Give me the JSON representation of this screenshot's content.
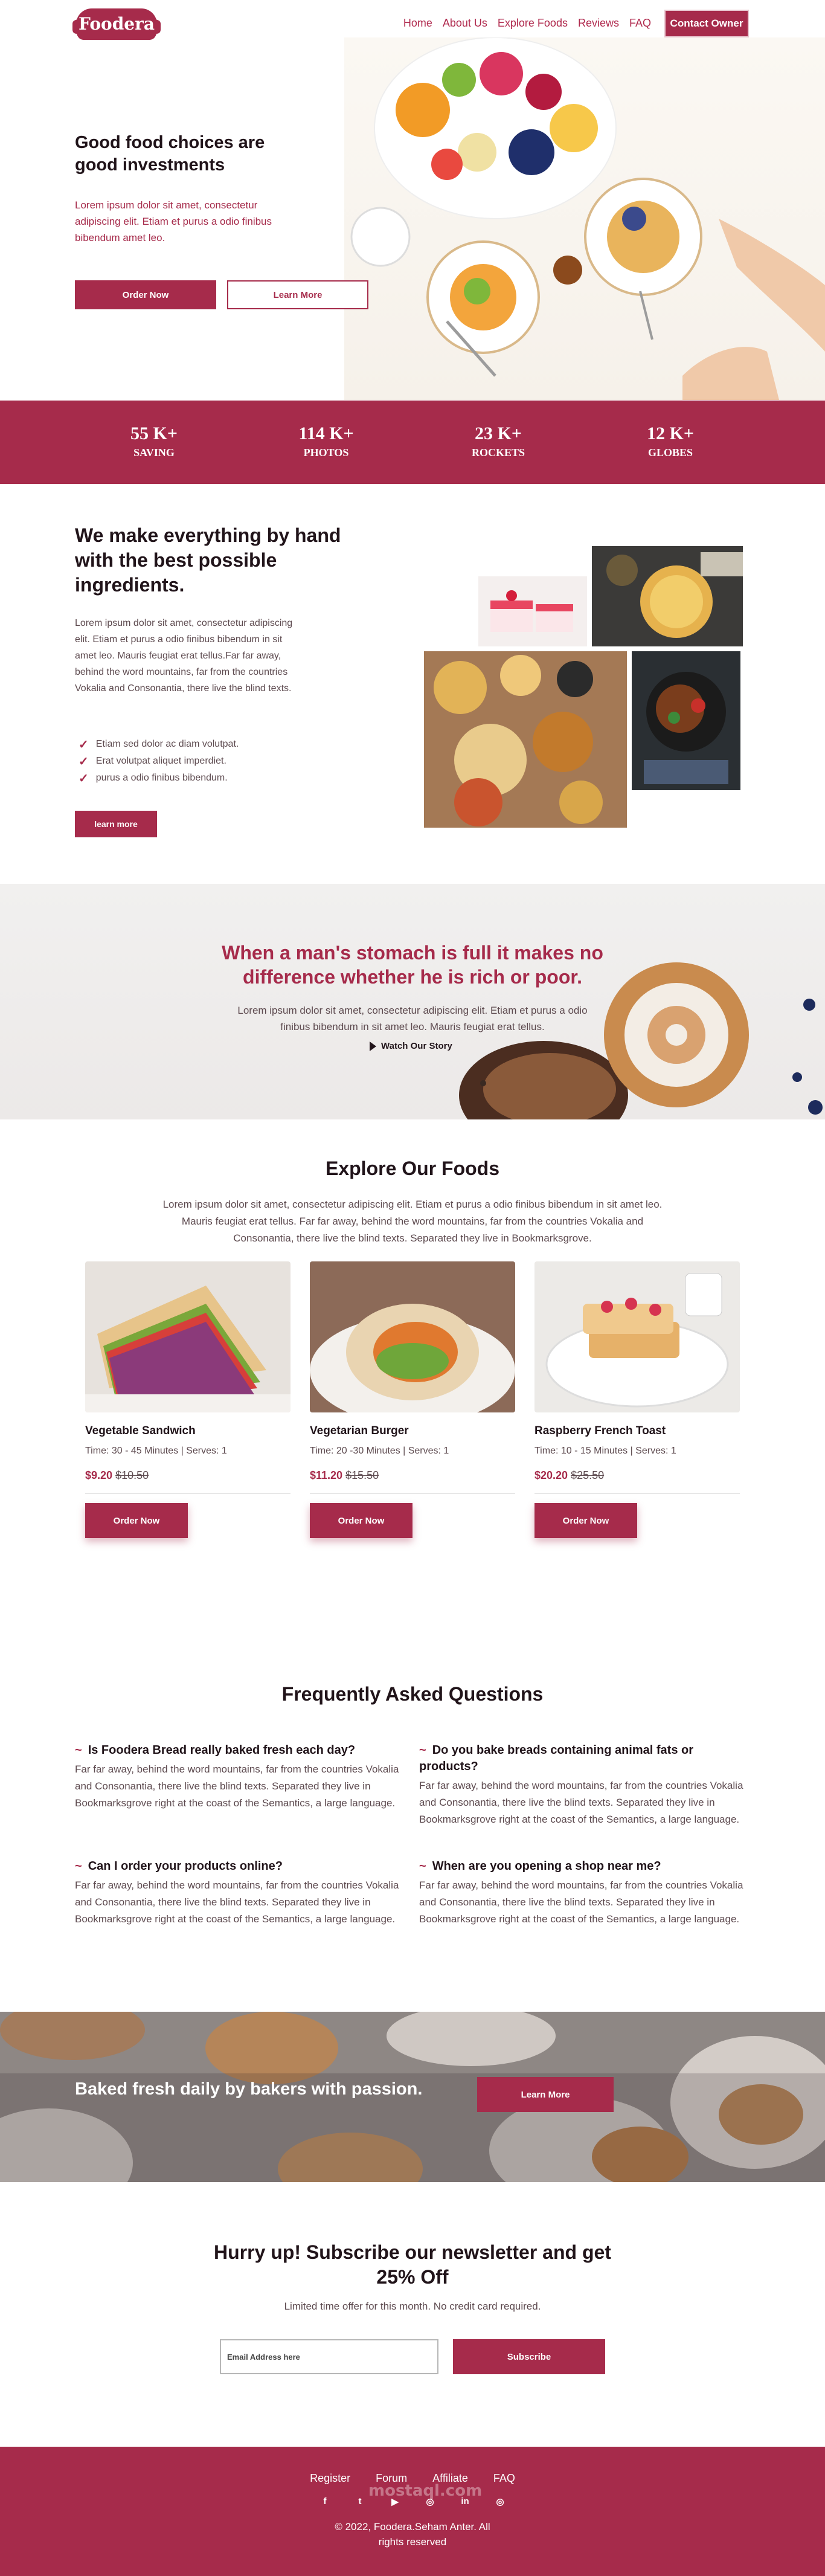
{
  "brand": {
    "logo_text": "Foodera",
    "primary_color": "#a62b4b",
    "dark_text": "#21141a"
  },
  "nav": {
    "links": [
      "Home",
      "About Us",
      "Explore Foods",
      "Reviews",
      "FAQ"
    ],
    "cta": "Contact Owner"
  },
  "hero": {
    "title": "Good food choices are good investments",
    "text": "Lorem ipsum dolor sit amet, consectetur adipiscing elit. Etiam et purus a odio finibus bibendum amet leo.",
    "primary_button": "Order Now",
    "secondary_button": "Learn More"
  },
  "stats": [
    {
      "value": "55 K+",
      "label": "SAVING"
    },
    {
      "value": "114 K+",
      "label": "PHOTOS"
    },
    {
      "value": "23 K+",
      "label": "ROCKETS"
    },
    {
      "value": "12 K+",
      "label": "GLOBES"
    }
  ],
  "about": {
    "title": "We make everything by hand with the best possible ingredients.",
    "text": "Lorem ipsum dolor sit amet, consectetur adipiscing elit. Etiam et purus a odio finibus bibendum in sit amet leo. Mauris feugiat erat tellus.Far far away, behind the word mountains, far from the countries Vokalia and Consonantia, there live the blind texts.",
    "checks": [
      "Etiam sed dolor ac diam volutpat.",
      "Erat volutpat aliquet imperdiet.",
      "purus a odio finibus bibendum."
    ],
    "button": "learn more"
  },
  "quote": {
    "title": "When a man's stomach is full it makes no difference whether he is rich or poor.",
    "text": "Lorem ipsum dolor sit amet, consectetur adipiscing elit. Etiam et purus a odio finibus bibendum in sit amet leo. Mauris feugiat erat tellus.",
    "watch": "Watch Our Story"
  },
  "explore": {
    "title": "Explore Our Foods",
    "text": "Lorem ipsum dolor sit amet, consectetur adipiscing elit. Etiam et purus a odio finibus bibendum in sit amet leo. Mauris feugiat erat tellus. Far far away, behind the word mountains, far from the countries Vokalia and Consonantia, there live the blind texts. Separated they live in Bookmarksgrove.",
    "foods": [
      {
        "name": "Vegetable Sandwich",
        "meta": "Time: 30 - 45 Minutes | Serves: 1",
        "price": "$9.20",
        "old_price": "$10.50",
        "button": "Order Now"
      },
      {
        "name": "Vegetarian Burger",
        "meta": "Time: 20 -30 Minutes | Serves: 1",
        "price": "$11.20",
        "old_price": "$15.50",
        "button": "Order Now"
      },
      {
        "name": "Raspberry French Toast",
        "meta": "Time: 10 - 15 Minutes | Serves: 1",
        "price": "$20.20",
        "old_price": "$25.50",
        "button": "Order Now"
      }
    ]
  },
  "faq": {
    "title": "Frequently Asked Questions",
    "items": [
      {
        "q": "Is Foodera Bread really baked fresh each day?",
        "a": "Far far away, behind the word mountains, far from the countries Vokalia and Consonantia, there live the blind texts. Separated they live in Bookmarksgrove right at the coast of the Semantics, a large language."
      },
      {
        "q": "Do you bake breads containing animal fats or products?",
        "a": "Far far away, behind the word mountains, far from the countries Vokalia and Consonantia, there live the blind texts. Separated they live in Bookmarksgrove right at the coast of the Semantics, a large language."
      },
      {
        "q": "Can I order your products online?",
        "a": "Far far away, behind the word mountains, far from the countries Vokalia and Consonantia, there live the blind texts. Separated they live in Bookmarksgrove right at the coast of the Semantics, a large language."
      },
      {
        "q": "When are you opening a shop near me?",
        "a": "Far far away, behind the word mountains, far from the countries Vokalia and Consonantia, there live the blind texts. Separated they live in Bookmarksgrove right at the coast of the Semantics, a large language."
      }
    ]
  },
  "bake": {
    "title": "Baked fresh daily by bakers with passion.",
    "button": "Learn More"
  },
  "newsletter": {
    "title": "Hurry up! Subscribe our newsletter and get 25% Off",
    "subtitle": "Limited time offer for this month. No credit card required.",
    "placeholder": "Email Address here",
    "button": "Subscribe"
  },
  "footer": {
    "links": [
      "Register",
      "Forum",
      "Affiliate",
      "FAQ"
    ],
    "socials": [
      "facebook-icon",
      "twitter-icon",
      "youtube-icon",
      "instagram-icon",
      "linkedin-icon",
      "instagram-icon"
    ],
    "social_glyphs": [
      "f",
      "t",
      "▶",
      "◎",
      "in",
      "◎"
    ],
    "copyright": "© 2022, Foodera.Seham Anter. All rights reserved",
    "watermark": "mostaql.com"
  }
}
